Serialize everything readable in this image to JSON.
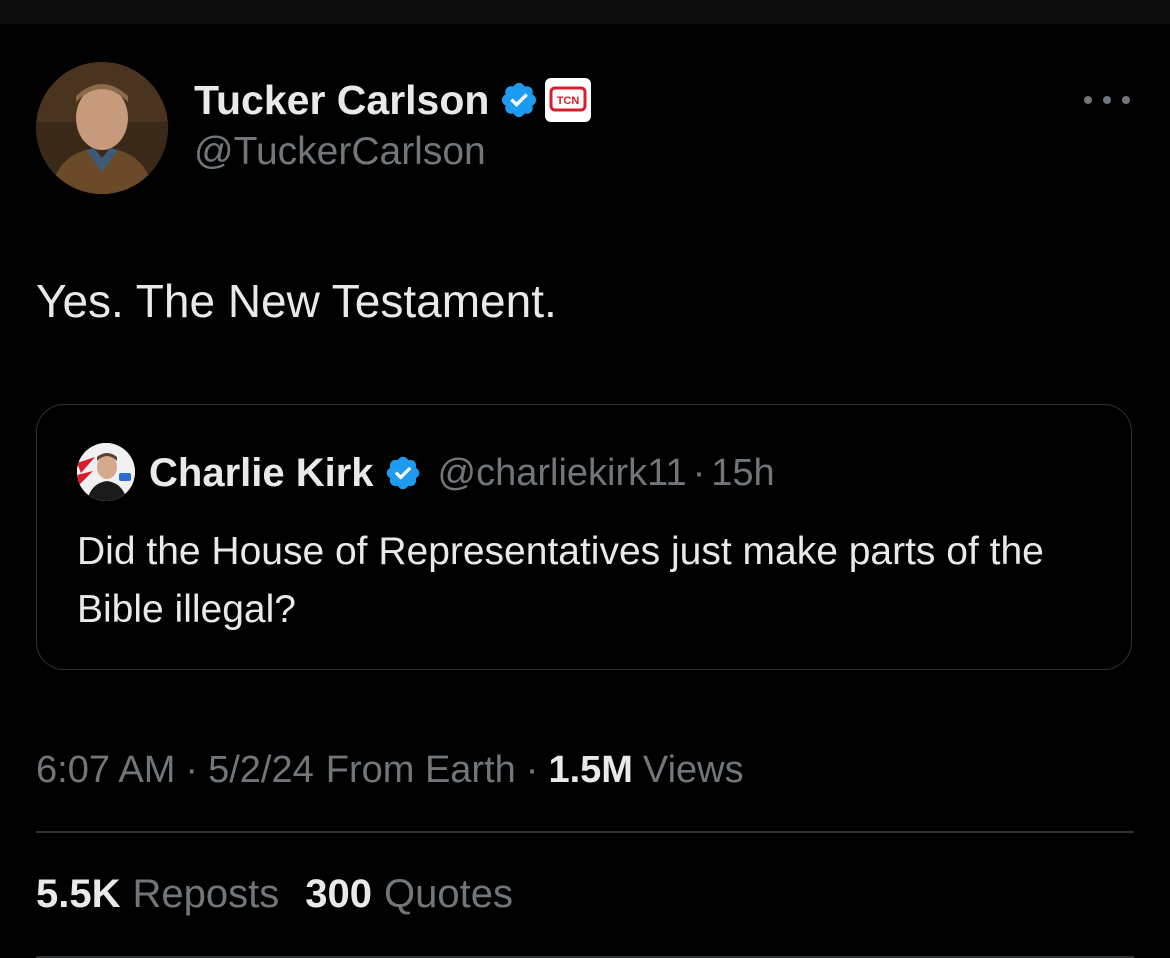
{
  "colors": {
    "background": "#000000",
    "primary_text": "#e7e9ea",
    "secondary_text": "#71767b",
    "border": "#2f3336",
    "verified_blue": "#1d9bf0",
    "affiliate_red": "#d81e2b"
  },
  "icons": {
    "verified": "verified-badge-icon",
    "affiliate": "affiliate-badge-icon",
    "more": "more-options-icon"
  },
  "tweet": {
    "author": {
      "display_name": "Tucker Carlson",
      "handle": "@TuckerCarlson",
      "affiliate_label": "TCN"
    },
    "text": "Yes. The New Testament.",
    "quoted_tweet": {
      "display_name": "Charlie Kirk",
      "handle": "@charliekirk11",
      "separator": "·",
      "time_ago": "15h",
      "text": "Did the House of Representatives just make parts of the Bible illegal?"
    },
    "meta": {
      "time": "6:07 AM",
      "date": "5/2/24",
      "source": "From Earth",
      "separator": "·",
      "views_count": "1.5M",
      "views_label": "Views"
    },
    "stats": {
      "reposts_count": "5.5K",
      "reposts_label": "Reposts",
      "quotes_count": "300",
      "quotes_label": "Quotes"
    }
  }
}
